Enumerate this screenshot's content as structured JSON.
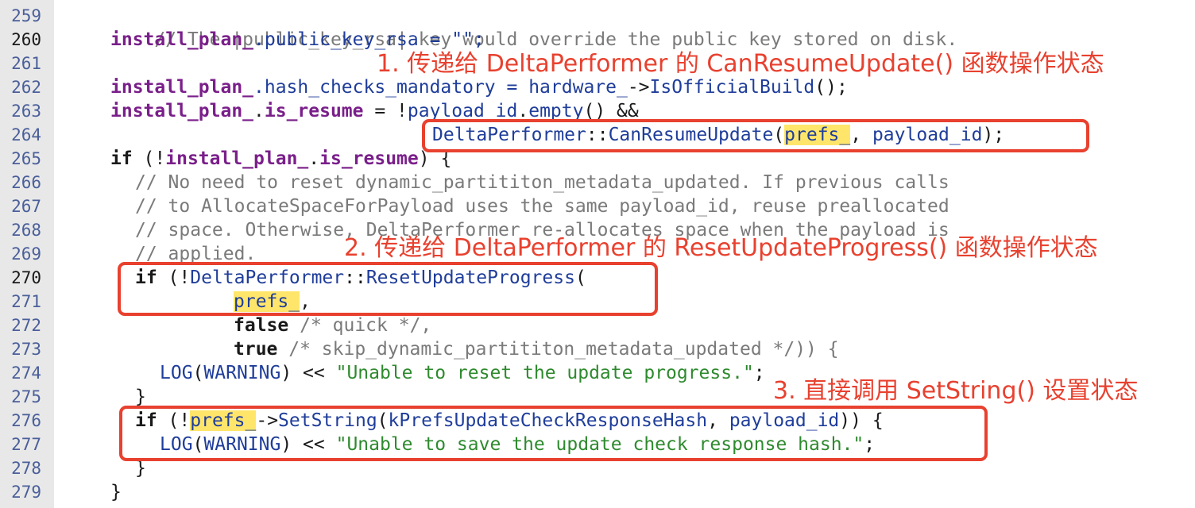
{
  "gutter": {
    "line_numbers": [
      "259",
      "260",
      "261",
      "262",
      "263",
      "264",
      "265",
      "266",
      "267",
      "268",
      "269",
      "270",
      "271",
      "272",
      "273",
      "274",
      "275",
      "276",
      "277",
      "278",
      "279"
    ]
  },
  "code": {
    "l259": {
      "c1": "// The |public_key_rsa| key would override the public key stored on disk."
    },
    "l260": {
      "t1": "install_plan_",
      "t2": ".public_key_rsa = \"\";"
    },
    "l262": {
      "t1": "install_plan_",
      "t2": ".hash_checks_mandatory = ",
      "t3": "hardware_",
      "t4": "->",
      "t5": "IsOfficialBuild",
      "t6": "();"
    },
    "l263": {
      "t1": "install_plan_",
      "t2": ".",
      "t3": "is_resume",
      "t4": " = !",
      "t5": "payload_id",
      "t6": ".",
      "t7": "empty",
      "t8": "() &&"
    },
    "l264": {
      "t1": "DeltaPerformer",
      "t2": "::",
      "t3": "CanResumeUpdate",
      "t4": "(",
      "t5": "prefs_",
      "t6": ", ",
      "t7": "payload_id",
      "t8": ");"
    },
    "l265": {
      "t1": "if",
      "t2": " (!",
      "t3": "install_plan_",
      "t4": ".",
      "t5": "is_resume",
      "t6": ") {"
    },
    "l266": {
      "c1": "// No need to reset dynamic_partititon_metadata_updated. If previous calls"
    },
    "l267": {
      "c1": "// to AllocateSpaceForPayload uses the same payload_id, reuse preallocated"
    },
    "l268": {
      "c1": "// space. Otherwise, DeltaPerformer re-allocates space when the payload is"
    },
    "l269": {
      "c1": "// applied."
    },
    "l270": {
      "t1": "if",
      "t2": " (!",
      "t3": "DeltaPerformer",
      "t4": "::",
      "t5": "ResetUpdateProgress",
      "t6": "("
    },
    "l271": {
      "t1": "prefs_",
      "t2": ","
    },
    "l272": {
      "t1": "false",
      "t2": " /* quick */,"
    },
    "l273": {
      "t1": "true",
      "t2": " /* skip_dynamic_partititon_metadata_updated */)) {"
    },
    "l274": {
      "t1": "LOG",
      "t2": "(",
      "t3": "WARNING",
      "t4": ") << ",
      "t5": "\"Unable to reset the update progress.\"",
      "t6": ";"
    },
    "l275": {
      "t1": "}"
    },
    "l276": {
      "t1": "if",
      "t2": " (!",
      "t3": "prefs_",
      "t4": "->",
      "t5": "SetString",
      "t6": "(",
      "t7": "kPrefsUpdateCheckResponseHash",
      "t8": ", ",
      "t9": "payload_id",
      "t10": ")) {"
    },
    "l277": {
      "t1": "LOG",
      "t2": "(",
      "t3": "WARNING",
      "t4": ") << ",
      "t5": "\"Unable to save the update check response hash.\"",
      "t6": ";"
    },
    "l278": {
      "t1": "}"
    },
    "l279": {
      "t1": "}"
    }
  },
  "annotations": [
    {
      "text": "1. 传递给 DeltaPerformer 的 CanResumeUpdate() 函数操作状态"
    },
    {
      "text": "2. 传递给 DeltaPerformer 的 ResetUpdateProgress() 函数操作状态"
    },
    {
      "text": "3. 直接调用 SetString() 设置状态"
    }
  ],
  "colors": {
    "annotation": "#e8412f",
    "highlight": "#ffe66b",
    "gutter_bg": "#e8e8e8",
    "line_number": "#4a5f9a",
    "comment": "#7a7a7a",
    "member": "#7a1f8a",
    "function": "#1f3d9a",
    "string": "#2e8a2e"
  }
}
